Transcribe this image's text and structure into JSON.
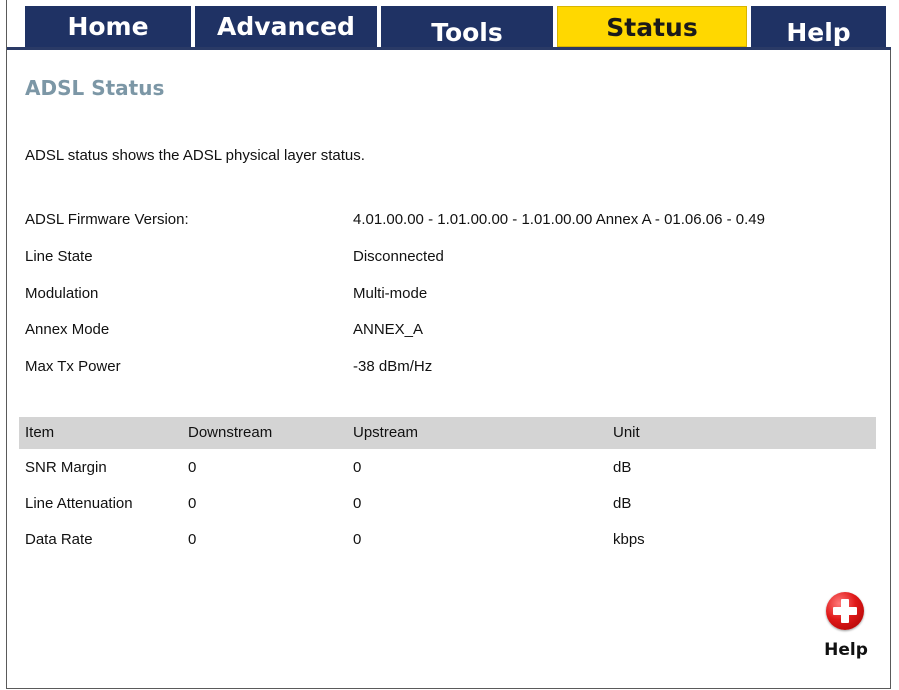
{
  "nav": {
    "tabs": [
      {
        "label": "Home",
        "active": false
      },
      {
        "label": "Advanced",
        "active": false
      },
      {
        "label": "Tools",
        "active": false
      },
      {
        "label": "Status",
        "active": true
      },
      {
        "label": "Help",
        "active": false
      }
    ]
  },
  "page": {
    "title": "ADSL Status",
    "description": "ADSL status shows the ADSL physical layer status."
  },
  "info": [
    {
      "label": "ADSL Firmware Version:",
      "value": "4.01.00.00 - 1.01.00.00 - 1.01.00.00 Annex A - 01.06.06 - 0.49"
    },
    {
      "label": "Line State",
      "value": "Disconnected"
    },
    {
      "label": "Modulation",
      "value": "Multi-mode"
    },
    {
      "label": "Annex Mode",
      "value": "ANNEX_A"
    },
    {
      "label": "Max Tx Power",
      "value": "-38 dBm/Hz"
    }
  ],
  "stats": {
    "headers": [
      "Item",
      "Downstream",
      "Upstream",
      "Unit"
    ],
    "rows": [
      [
        "SNR Margin",
        "0",
        "0",
        "dB"
      ],
      [
        "Line Attenuation",
        "0",
        "0",
        "dB"
      ],
      [
        "Data Rate",
        "0",
        "0",
        "kbps"
      ]
    ]
  },
  "help_button": {
    "label": "Help",
    "icon": "help-plus-icon"
  },
  "colors": {
    "tab_bg": "#1f3264",
    "tab_active_bg": "#ffd800",
    "title": "#7c97a6",
    "table_header_bg": "#d4d4d4",
    "help_icon": "#e01919"
  }
}
